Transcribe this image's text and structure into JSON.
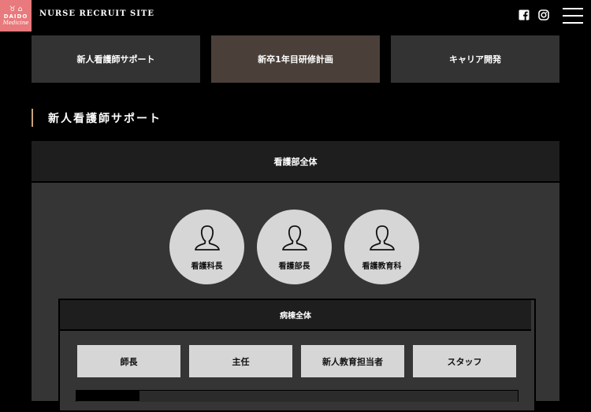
{
  "header": {
    "logo": {
      "mark": "♉ ⌂",
      "text": "DAIDO",
      "sub": "Medicine"
    },
    "site_title": "NURSE RECRUIT SITE",
    "social": [
      "facebook-icon",
      "instagram-icon"
    ]
  },
  "tabs": [
    {
      "label": "新人看護師サポート",
      "color": "#333333"
    },
    {
      "label": "新卒1年目研修計画",
      "color": "#4a4039"
    },
    {
      "label": "キャリア開発",
      "color": "#333333"
    }
  ],
  "section": {
    "title": "新人看護師サポート",
    "accent": "#c9a27a"
  },
  "org": {
    "panel_title": "看護部全体",
    "roles": [
      "看護科長",
      "看護部長",
      "看護教育科"
    ],
    "ward": {
      "title": "病棟全体",
      "staff": [
        "師長",
        "主任",
        "新人教育担当者",
        "スタッフ"
      ]
    }
  }
}
